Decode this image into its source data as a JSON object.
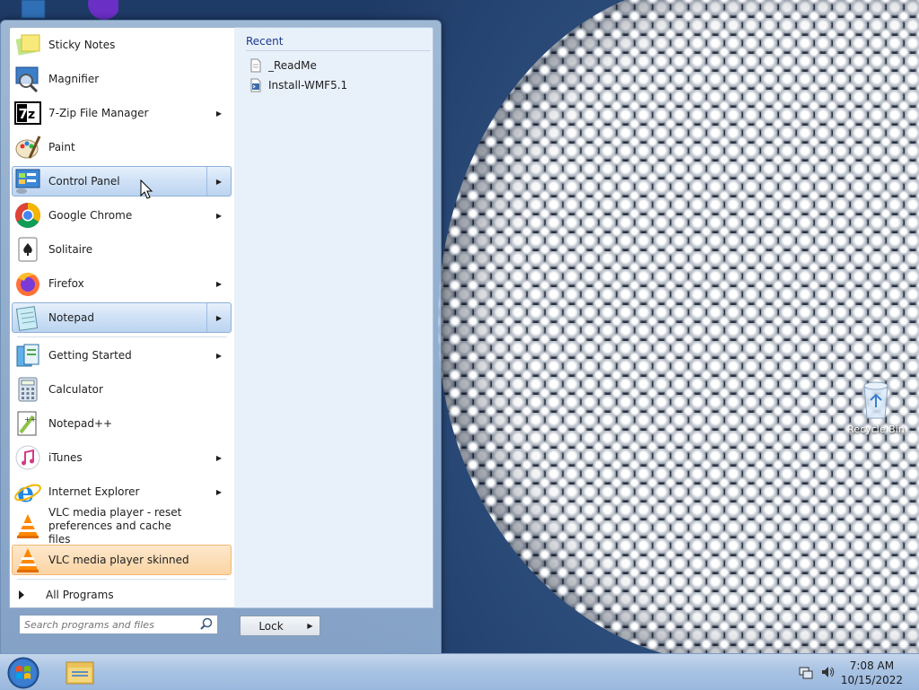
{
  "desktop": {
    "recycle_bin_label": "Recycle Bin"
  },
  "start_menu": {
    "programs": [
      {
        "label": "Sticky Notes",
        "icon": "sticky-notes-icon",
        "submenu": false
      },
      {
        "label": "Magnifier",
        "icon": "magnifier-icon",
        "submenu": false
      },
      {
        "label": "7-Zip File Manager",
        "icon": "7zip-icon",
        "submenu": true
      },
      {
        "label": "Paint",
        "icon": "paint-icon",
        "submenu": false
      },
      {
        "label": "Control Panel",
        "icon": "control-panel-icon",
        "submenu": true,
        "state": "hover"
      },
      {
        "label": "Google Chrome",
        "icon": "chrome-icon",
        "submenu": true
      },
      {
        "label": "Solitaire",
        "icon": "solitaire-icon",
        "submenu": false
      },
      {
        "label": "Firefox",
        "icon": "firefox-icon",
        "submenu": true
      },
      {
        "label": "Notepad",
        "icon": "notepad-icon",
        "submenu": true,
        "state": "selected"
      },
      {
        "label": "Getting Started",
        "icon": "getting-started-icon",
        "submenu": true
      },
      {
        "label": "Calculator",
        "icon": "calculator-icon",
        "submenu": false
      },
      {
        "label": "Notepad++",
        "icon": "notepadpp-icon",
        "submenu": false
      },
      {
        "label": "iTunes",
        "icon": "itunes-icon",
        "submenu": true
      },
      {
        "label": "Internet Explorer",
        "icon": "ie-icon",
        "submenu": true
      },
      {
        "label": "VLC media player - reset preferences and cache files",
        "icon": "vlc-icon",
        "submenu": false
      },
      {
        "label": "VLC media player skinned",
        "icon": "vlc-icon",
        "submenu": false,
        "state": "new-highlight"
      }
    ],
    "all_programs_label": "All Programs",
    "recent": {
      "header": "Recent",
      "items": [
        {
          "label": "_ReadMe",
          "icon": "text-file-icon"
        },
        {
          "label": "Install-WMF5.1",
          "icon": "powershell-script-icon"
        }
      ]
    },
    "search": {
      "placeholder": "Search programs and files",
      "value": ""
    },
    "lock_label": "Lock"
  },
  "taskbar": {
    "clock_time": "7:08 AM",
    "clock_date": "10/15/2022"
  },
  "colors": {
    "hover_highlight": "#cfe1f6",
    "new_program_highlight": "#fcd4a4",
    "recent_header": "#1e3a8a",
    "taskbar": "#a9c3e3"
  }
}
